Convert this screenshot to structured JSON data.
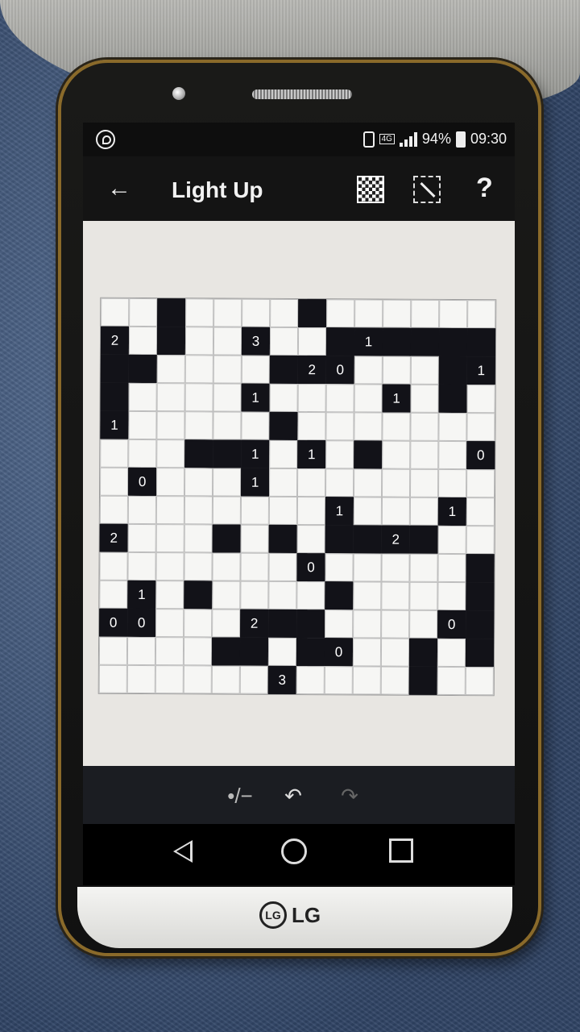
{
  "status": {
    "network": "4G",
    "battery": "94%",
    "time": "09:30"
  },
  "toolbar": {
    "title": "Light Up"
  },
  "logo": {
    "brand": "LG"
  },
  "grid": {
    "rows": 14,
    "cols": 14,
    "black": [
      [
        0,
        2
      ],
      [
        0,
        7
      ],
      [
        1,
        0
      ],
      [
        1,
        2
      ],
      [
        1,
        8
      ],
      [
        1,
        9
      ],
      [
        1,
        10
      ],
      [
        1,
        11
      ],
      [
        1,
        12
      ],
      [
        1,
        13
      ],
      [
        1,
        0
      ],
      [
        2,
        0
      ],
      [
        2,
        1
      ],
      [
        2,
        6
      ],
      [
        2,
        7
      ],
      [
        2,
        8
      ],
      [
        2,
        12
      ],
      [
        2,
        13
      ],
      [
        3,
        0
      ],
      [
        3,
        5
      ],
      [
        3,
        10
      ],
      [
        3,
        12
      ],
      [
        4,
        0
      ],
      [
        4,
        6
      ],
      [
        5,
        3
      ],
      [
        5,
        4
      ],
      [
        5,
        5
      ],
      [
        5,
        7
      ],
      [
        5,
        9
      ],
      [
        5,
        13
      ],
      [
        6,
        1
      ],
      [
        6,
        5
      ],
      [
        7,
        8
      ],
      [
        7,
        12
      ],
      [
        8,
        0
      ],
      [
        8,
        4
      ],
      [
        8,
        6
      ],
      [
        8,
        8
      ],
      [
        8,
        9
      ],
      [
        8,
        10
      ],
      [
        8,
        11
      ],
      [
        9,
        7
      ],
      [
        9,
        13
      ],
      [
        10,
        1
      ],
      [
        10,
        3
      ],
      [
        10,
        8
      ],
      [
        10,
        13
      ],
      [
        11,
        0
      ],
      [
        11,
        1
      ],
      [
        11,
        6
      ],
      [
        11,
        7
      ],
      [
        11,
        12
      ],
      [
        11,
        13
      ],
      [
        12,
        4
      ],
      [
        12,
        5
      ],
      [
        12,
        7
      ],
      [
        12,
        8
      ],
      [
        12,
        11
      ],
      [
        12,
        13
      ],
      [
        13,
        6
      ],
      [
        13,
        11
      ]
    ],
    "clues": [
      {
        "r": 1,
        "c": 0,
        "v": "2"
      },
      {
        "r": 1,
        "c": 5,
        "v": "3"
      },
      {
        "r": 1,
        "c": 9,
        "v": "1"
      },
      {
        "r": 2,
        "c": 7,
        "v": "2"
      },
      {
        "r": 2,
        "c": 8,
        "v": "0"
      },
      {
        "r": 2,
        "c": 13,
        "v": "1"
      },
      {
        "r": 3,
        "c": 5,
        "v": "1"
      },
      {
        "r": 3,
        "c": 10,
        "v": "1"
      },
      {
        "r": 4,
        "c": 0,
        "v": "1"
      },
      {
        "r": 5,
        "c": 5,
        "v": "1"
      },
      {
        "r": 5,
        "c": 7,
        "v": "1"
      },
      {
        "r": 5,
        "c": 13,
        "v": "0"
      },
      {
        "r": 6,
        "c": 1,
        "v": "0"
      },
      {
        "r": 6,
        "c": 5,
        "v": "1"
      },
      {
        "r": 7,
        "c": 8,
        "v": "1"
      },
      {
        "r": 7,
        "c": 12,
        "v": "1"
      },
      {
        "r": 8,
        "c": 0,
        "v": "2"
      },
      {
        "r": 8,
        "c": 10,
        "v": "2"
      },
      {
        "r": 9,
        "c": 7,
        "v": "0"
      },
      {
        "r": 10,
        "c": 1,
        "v": "1"
      },
      {
        "r": 11,
        "c": 0,
        "v": "0"
      },
      {
        "r": 11,
        "c": 1,
        "v": "0"
      },
      {
        "r": 11,
        "c": 5,
        "v": "2"
      },
      {
        "r": 11,
        "c": 12,
        "v": "0"
      },
      {
        "r": 12,
        "c": 8,
        "v": "0"
      },
      {
        "r": 13,
        "c": 6,
        "v": "3"
      }
    ]
  }
}
